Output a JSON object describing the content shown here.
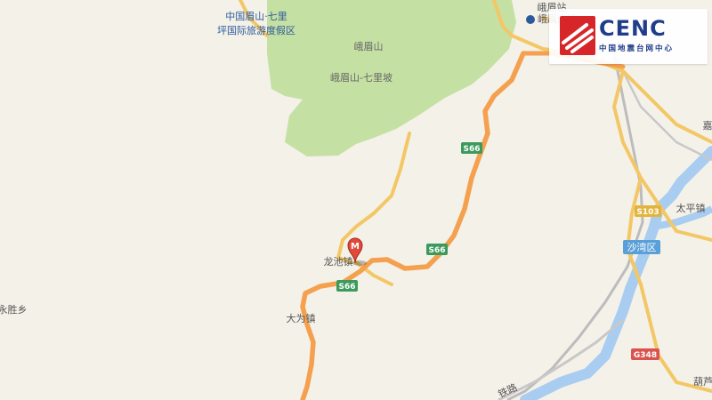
{
  "map": {
    "places": {
      "scenic_area": "中国眉山·七里",
      "scenic_area_2": "坪国际旅游度假区",
      "mountain": "峨眉山",
      "mountain_qilipo": "峨眉山-七里坡",
      "station": "峨眉站",
      "emeishan_city": "峨眉山站",
      "longchi": "龙池镇",
      "dawei": "大为镇",
      "yongsheng": "永胜乡",
      "taiping": "太平镇",
      "shawan": "沙湾区",
      "hulu": "葫芦",
      "jia": "嘉",
      "railway": "铁路"
    },
    "shields": {
      "s66_a": "S66",
      "s66_b": "S66",
      "s66_c": "S66",
      "s103": "S103",
      "g348": "G348"
    },
    "marker_letter": "M",
    "colors": {
      "background": "#f4f1e9",
      "park": "#c5e0a3",
      "highway": "#f5a04e",
      "road": "#f3c766",
      "river": "#a9cdf0",
      "marker": "#e04a3a",
      "shield_green": "#3c9a5b",
      "shield_yellow": "#e3b43c"
    }
  },
  "logo": {
    "brand": "CENC",
    "subtitle": "中国地震台网中心"
  }
}
